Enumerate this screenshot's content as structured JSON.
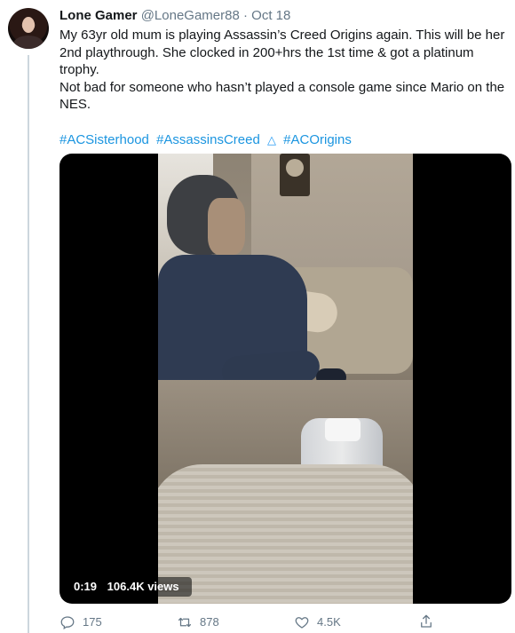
{
  "tweet": {
    "display_name": "Lone Gamer",
    "handle": "@LoneGamer88",
    "separator": "·",
    "date": "Oct 18",
    "text_paragraph_1": "My 63yr old mum is playing Assassin’s Creed Origins again. This will be her 2nd playthrough. She clocked in 200+hrs the 1st time & got a platinum trophy.",
    "text_paragraph_2": "Not bad for someone who hasn’t played a console game since Mario on the NES.",
    "hashtags": [
      "#ACSisterhood",
      "#AssassinsCreed",
      "#ACOrigins"
    ]
  },
  "media": {
    "duration": "0:19",
    "views": "106.4K views"
  },
  "actions": {
    "replies": "175",
    "retweets": "878",
    "likes": "4.5K"
  },
  "icons": {
    "reply": "reply-icon",
    "retweet": "retweet-icon",
    "like": "heart-icon",
    "share": "share-icon",
    "emoji": "assassins-creed-emoji-icon"
  },
  "colors": {
    "link": "#1b95e0",
    "secondary_text": "#657786",
    "thread_line": "#ccd6dd"
  }
}
